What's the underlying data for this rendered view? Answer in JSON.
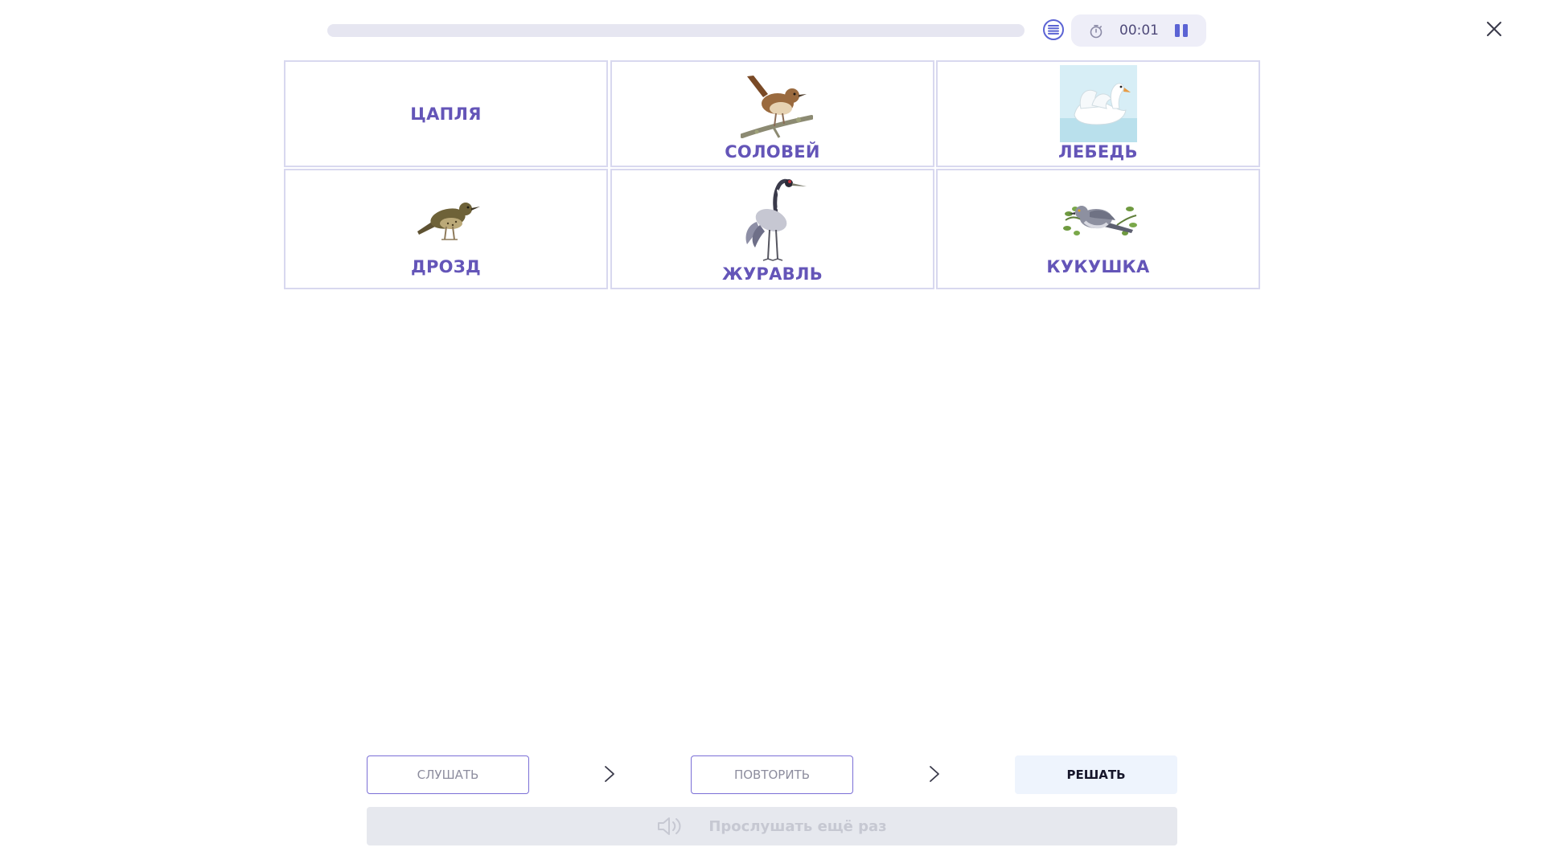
{
  "header": {
    "progress_fraction": 0,
    "timer": "00:01",
    "icons": {
      "list": "list-icon",
      "timer": "stopwatch-icon",
      "pause": "pause-icon",
      "close": "close-icon"
    }
  },
  "cards": [
    {
      "label": "ЦАПЛЯ",
      "picture": "none"
    },
    {
      "label": "СОЛОВЕЙ",
      "picture": "nightingale"
    },
    {
      "label": "ЛЕБЕДЬ",
      "picture": "swan"
    },
    {
      "label": "ДРОЗД",
      "picture": "thrush"
    },
    {
      "label": "ЖУРАВЛЬ",
      "picture": "crane"
    },
    {
      "label": "КУКУШКА",
      "picture": "cuckoo"
    }
  ],
  "steps": {
    "listen": "СЛУШАТЬ",
    "repeat": "ПОВТОРИТЬ",
    "solve": "РЕШАТЬ"
  },
  "listen_again": {
    "label": "Прослушать ещё раз",
    "icon": "speaker-icon"
  },
  "colors": {
    "accent": "#5b63d4",
    "label": "#6455b8",
    "card_border": "#d8d8ef",
    "timer_bg": "#eeeef8"
  }
}
